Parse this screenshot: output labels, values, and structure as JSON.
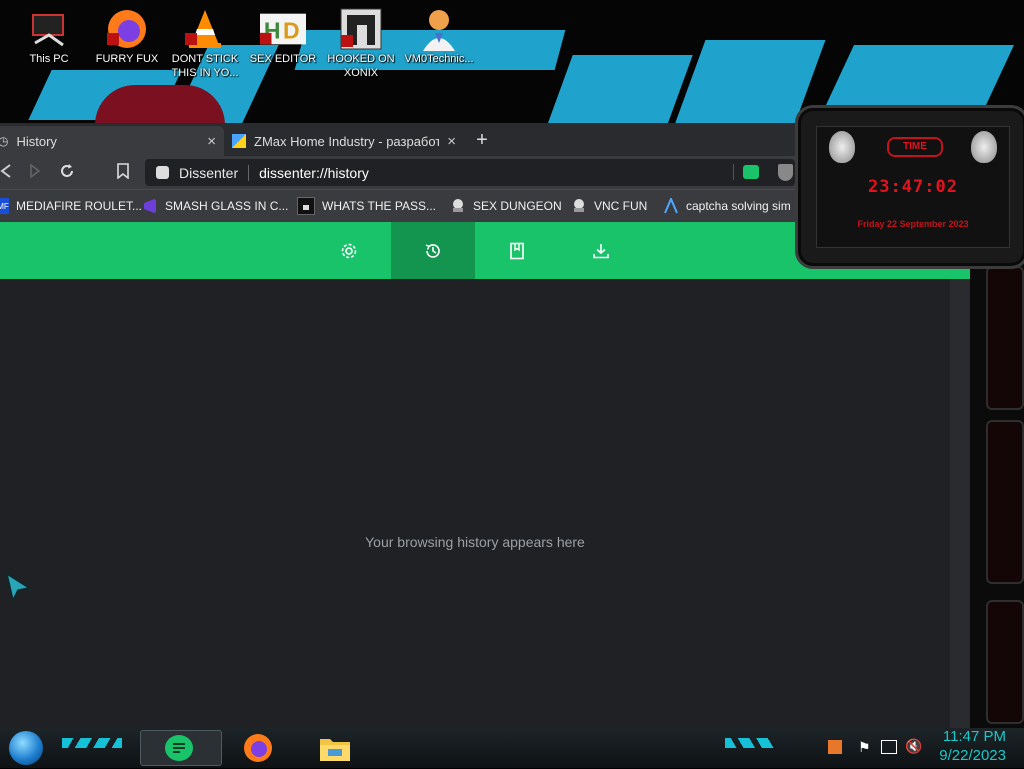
{
  "desktop": {
    "icons": [
      {
        "label": "This PC",
        "icon": "computer-icon"
      },
      {
        "label": "FURRY FUX",
        "icon": "firefox-icon"
      },
      {
        "label": "DONT STICK THIS IN YO...",
        "icon": "vlc-icon"
      },
      {
        "label": "SEX EDITOR",
        "icon": "hxd-icon"
      },
      {
        "label": "HOOKED ON XONIX",
        "icon": "xonix-icon"
      },
      {
        "label": "VM0Technic...",
        "icon": "doctor-icon"
      }
    ]
  },
  "browser": {
    "tabs": [
      {
        "title": "History",
        "active": true
      },
      {
        "title": "ZMax Home Industry - разработк",
        "active": false
      }
    ],
    "omnibox": {
      "site_label": "Dissenter",
      "url": "dissenter://history"
    },
    "bookmarks": [
      {
        "label": "MEDIAFIRE ROULET...",
        "icon": "mediafire-icon"
      },
      {
        "label": "SMASH GLASS IN C...",
        "icon": "vs-icon"
      },
      {
        "label": "WHATS THE PASS...",
        "icon": "lock-icon"
      },
      {
        "label": "SEX DUNGEON",
        "icon": "ghost-icon"
      },
      {
        "label": "VNC FUN",
        "icon": "ghost-icon"
      },
      {
        "label": "captcha solving sim",
        "icon": "arch-icon"
      }
    ],
    "history_nav": [
      {
        "name": "settings",
        "icon": "gear-icon"
      },
      {
        "name": "history",
        "icon": "history-icon",
        "active": true
      },
      {
        "name": "bookmarks",
        "icon": "bookmark-icon"
      },
      {
        "name": "downloads",
        "icon": "download-icon"
      }
    ],
    "empty_message": "Your browsing history appears here"
  },
  "gadget": {
    "title": "TIME",
    "time": "23:47:02",
    "date": "Friday 22 September 2023"
  },
  "taskbar": {
    "time": "11:47 PM",
    "date": "9/22/2023"
  },
  "colors": {
    "accent_green": "#19c36a",
    "accent_green_active": "#13944f",
    "clock_red": "#e0141e",
    "tray_cyan": "#19c8c8"
  }
}
